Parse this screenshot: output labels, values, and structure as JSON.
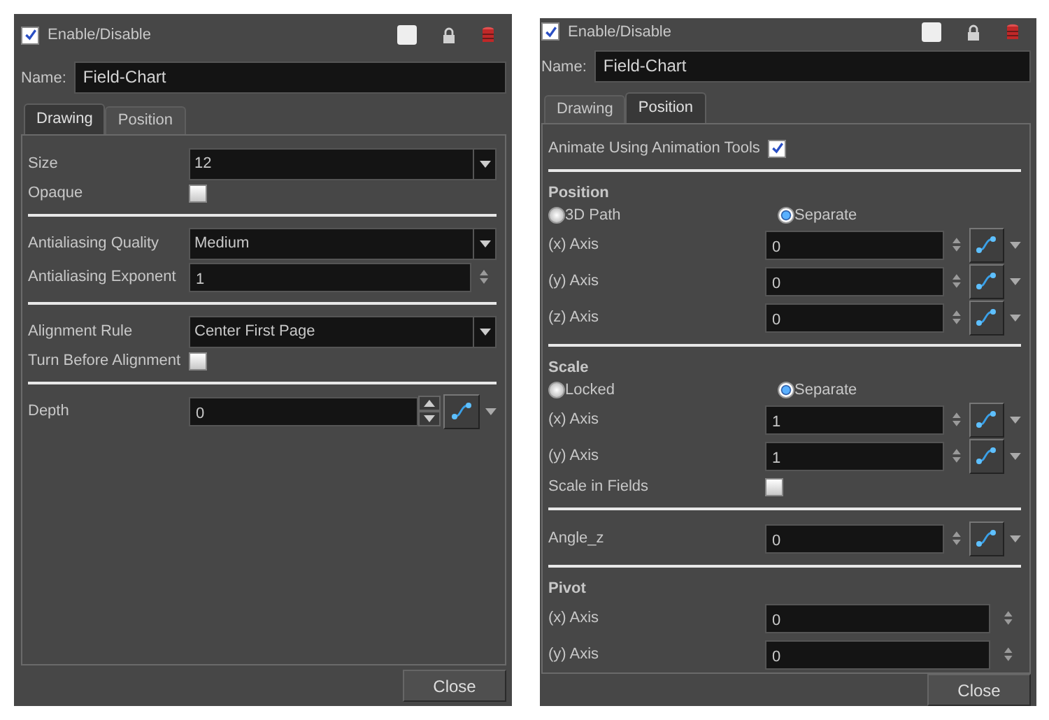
{
  "panels": [
    {
      "enable": {
        "label": "Enable/Disable",
        "checked": true
      },
      "name_label": "Name:",
      "name_value": "Field-Chart",
      "tabs": [
        {
          "label": "Drawing",
          "selected": true
        },
        {
          "label": "Position",
          "selected": false
        }
      ],
      "rows": [
        {
          "kind": "dropdown",
          "label": "Size",
          "value": "12"
        },
        {
          "kind": "checkbox",
          "label": "Opaque",
          "checked": false
        },
        {
          "kind": "divider"
        },
        {
          "kind": "dropdown",
          "label": "Antialiasing Quality",
          "value": "Medium"
        },
        {
          "kind": "number",
          "label": "Antialiasing Exponent",
          "value": "1",
          "function": false
        },
        {
          "kind": "divider"
        },
        {
          "kind": "dropdown",
          "label": "Alignment Rule",
          "value": "Center First Page"
        },
        {
          "kind": "checkbox",
          "label": "Turn Before Alignment",
          "checked": false
        },
        {
          "kind": "divider"
        },
        {
          "kind": "stepper",
          "label": "Depth",
          "value": "0",
          "function": true
        }
      ],
      "close": "Close"
    },
    {
      "enable": {
        "label": "Enable/Disable",
        "checked": true
      },
      "name_label": "Name:",
      "name_value": "Field-Chart",
      "tabs": [
        {
          "label": "Drawing",
          "selected": false
        },
        {
          "label": "Position",
          "selected": true
        }
      ],
      "rows": [
        {
          "kind": "checkbox",
          "label": "Animate Using Animation Tools",
          "checked": true
        },
        {
          "kind": "divider"
        },
        {
          "kind": "heading",
          "label": "Position"
        },
        {
          "kind": "radios",
          "options": [
            {
              "label": "3D Path",
              "selected": false
            },
            {
              "label": "Separate",
              "selected": true
            }
          ]
        },
        {
          "kind": "number",
          "label": "(x) Axis",
          "value": "0",
          "function": true
        },
        {
          "kind": "number",
          "label": "(y) Axis",
          "value": "0",
          "function": true
        },
        {
          "kind": "number",
          "label": "(z) Axis",
          "value": "0",
          "function": true
        },
        {
          "kind": "divider"
        },
        {
          "kind": "heading",
          "label": "Scale"
        },
        {
          "kind": "radios",
          "options": [
            {
              "label": "Locked",
              "selected": false
            },
            {
              "label": "Separate",
              "selected": true
            }
          ]
        },
        {
          "kind": "number",
          "label": "(x) Axis",
          "value": "1",
          "function": true
        },
        {
          "kind": "number",
          "label": "(y) Axis",
          "value": "1",
          "function": true
        },
        {
          "kind": "checkbox",
          "label": "Scale in Fields",
          "checked": false
        },
        {
          "kind": "divider"
        },
        {
          "kind": "number",
          "label": "Angle_z",
          "value": "0",
          "function": true
        },
        {
          "kind": "divider"
        },
        {
          "kind": "heading",
          "label": "Pivot"
        },
        {
          "kind": "number",
          "label": "(x) Axis",
          "value": "0",
          "function": false
        },
        {
          "kind": "number",
          "label": "(y) Axis",
          "value": "0",
          "function": false
        }
      ],
      "close": "Close"
    }
  ]
}
